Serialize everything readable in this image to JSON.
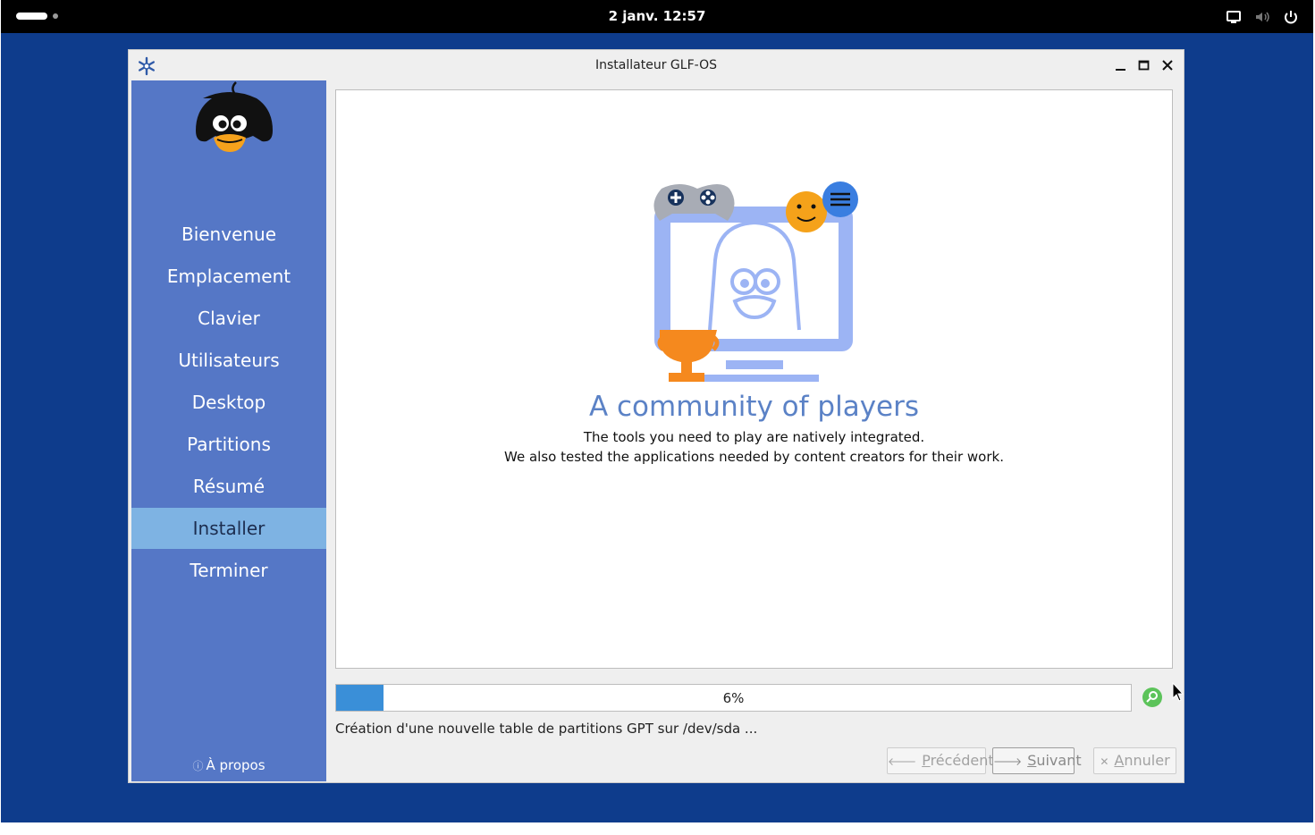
{
  "topbar": {
    "clock": "2 janv.  12:57",
    "tray_icons": [
      "screen-icon",
      "speaker-icon",
      "power-icon"
    ]
  },
  "window": {
    "title": "Installateur GLF-OS",
    "controls": [
      "minimize-icon",
      "maximize-icon",
      "close-icon"
    ]
  },
  "sidebar": {
    "items": [
      {
        "label": "Bienvenue"
      },
      {
        "label": "Emplacement"
      },
      {
        "label": "Clavier"
      },
      {
        "label": "Utilisateurs"
      },
      {
        "label": "Desktop"
      },
      {
        "label": "Partitions"
      },
      {
        "label": "Résumé"
      },
      {
        "label": "Installer",
        "active": true
      },
      {
        "label": "Terminer"
      }
    ],
    "about_label": "À propos"
  },
  "slide": {
    "title": "A community of players",
    "line1": "The tools you need to play are natively integrated.",
    "line2": "We also tested the applications needed by content creators for their work."
  },
  "progress": {
    "percent": 6,
    "label": "6%",
    "status": "Création d'une nouvelle table de partitions GPT sur /dev/sda ..."
  },
  "buttons": {
    "previous_prefix": "P",
    "previous_rest": "récédent",
    "next_prefix": "S",
    "next_rest": "uivant",
    "cancel_prefix": "A",
    "cancel_rest": "nnuler"
  },
  "colors": {
    "desktop": "#0e3c8c",
    "sidebar": "#5577c6",
    "sidebar_active": "#7eb3e3",
    "progress_fill": "#3a8fd8",
    "slide_title": "#5b82c6",
    "illustration_blue": "#9cb4f4",
    "trophy_orange": "#f5891e"
  }
}
